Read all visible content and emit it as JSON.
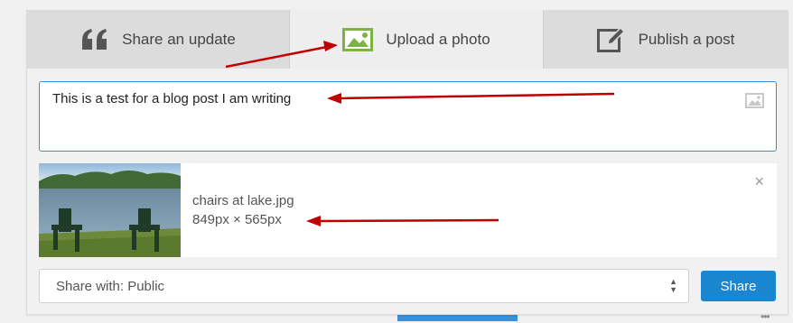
{
  "tabs": [
    {
      "label": "Share an update",
      "icon": "quote-icon"
    },
    {
      "label": "Upload a photo",
      "icon": "photo-icon"
    },
    {
      "label": "Publish a post",
      "icon": "edit-icon"
    }
  ],
  "composer": {
    "text": "This is a test for a blog post I am writing",
    "icon": "image-icon"
  },
  "attachment": {
    "file_name": "chairs at lake.jpg",
    "dimensions": "849px × 565px",
    "close_label": "×",
    "thumbnail": "lake-with-chairs-thumbnail"
  },
  "share_with": {
    "label": "Share with: Public"
  },
  "share_button": {
    "label": "Share"
  },
  "colors": {
    "accent": "#1a86cf",
    "photo_icon": "#7cb342",
    "annotation_arrow": "#c00000"
  }
}
